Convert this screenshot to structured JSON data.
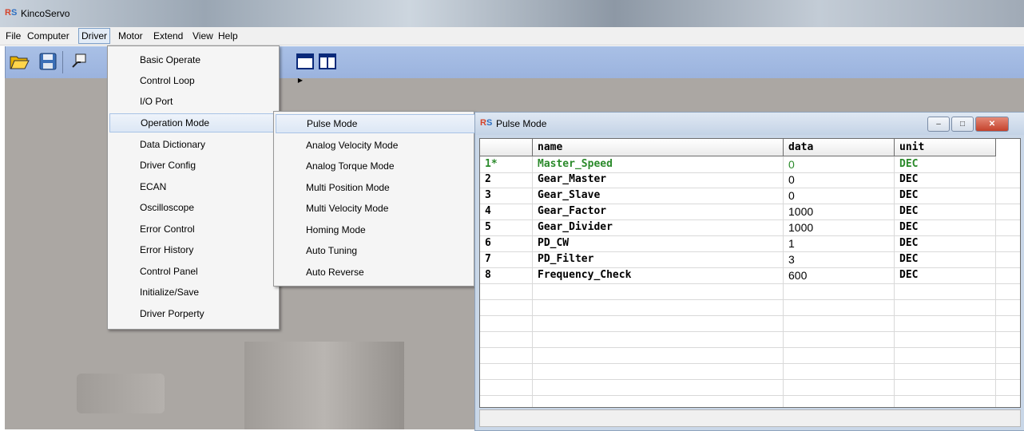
{
  "window": {
    "title": "KincoServo",
    "icon_text": [
      "R",
      "S"
    ]
  },
  "menubar": {
    "items": [
      "File",
      "Computer",
      "Driver",
      "Motor",
      "Extend",
      "View",
      "Help"
    ],
    "active": "Driver"
  },
  "toolbar": {
    "icons": [
      "open-folder-icon",
      "save-icon",
      "connect-icon",
      "window-icon",
      "columns-icon"
    ]
  },
  "driver_menu": {
    "items": [
      {
        "label": "Basic Operate",
        "submenu": false
      },
      {
        "label": "Control Loop",
        "submenu": true
      },
      {
        "label": "I/O Port",
        "submenu": false
      },
      {
        "label": "Operation Mode",
        "submenu": true
      },
      {
        "label": "Data Dictionary",
        "submenu": false
      },
      {
        "label": "Driver Config",
        "submenu": false
      },
      {
        "label": "ECAN",
        "submenu": true
      },
      {
        "label": "Oscilloscope",
        "submenu": false
      },
      {
        "label": "Error Control",
        "submenu": false
      },
      {
        "label": "Error History",
        "submenu": false
      },
      {
        "label": "Control Panel",
        "submenu": true
      },
      {
        "label": "Initialize/Save",
        "submenu": false
      },
      {
        "label": "Driver Porperty",
        "submenu": false
      }
    ],
    "highlighted": "Operation Mode"
  },
  "operation_mode_menu": {
    "items": [
      "Pulse Mode",
      "Analog Velocity Mode",
      "Analog Torque Mode",
      "Multi Position Mode",
      "Multi Velocity Mode",
      "Homing Mode",
      "Auto Tuning",
      "Auto Reverse"
    ],
    "highlighted": "Pulse Mode"
  },
  "child_window": {
    "title": "Pulse Mode",
    "icon_text": [
      "R",
      "S"
    ],
    "buttons": {
      "minimize": "–",
      "maximize": "□",
      "close": "✕"
    },
    "table": {
      "headers": [
        "",
        "name",
        "data",
        "unit"
      ],
      "rows": [
        {
          "idx": "1*",
          "name": "Master_Speed",
          "data": "0",
          "unit": "DEC",
          "selected": true
        },
        {
          "idx": "2",
          "name": "Gear_Master",
          "data": "0",
          "unit": "DEC"
        },
        {
          "idx": "3",
          "name": "Gear_Slave",
          "data": "0",
          "unit": "DEC"
        },
        {
          "idx": "4",
          "name": "Gear_Factor",
          "data": "1000",
          "unit": "DEC"
        },
        {
          "idx": "5",
          "name": "Gear_Divider",
          "data": "1000",
          "unit": "DEC"
        },
        {
          "idx": "6",
          "name": "PD_CW",
          "data": "1",
          "unit": "DEC"
        },
        {
          "idx": "7",
          "name": "PD_Filter",
          "data": "3",
          "unit": "DEC"
        },
        {
          "idx": "8",
          "name": "Frequency_Check",
          "data": "600",
          "unit": "DEC"
        }
      ]
    }
  },
  "colors": {
    "accent": "#a9c0e6",
    "selected_row_text": "#2b8a2b",
    "close_button": "#c4422c"
  }
}
